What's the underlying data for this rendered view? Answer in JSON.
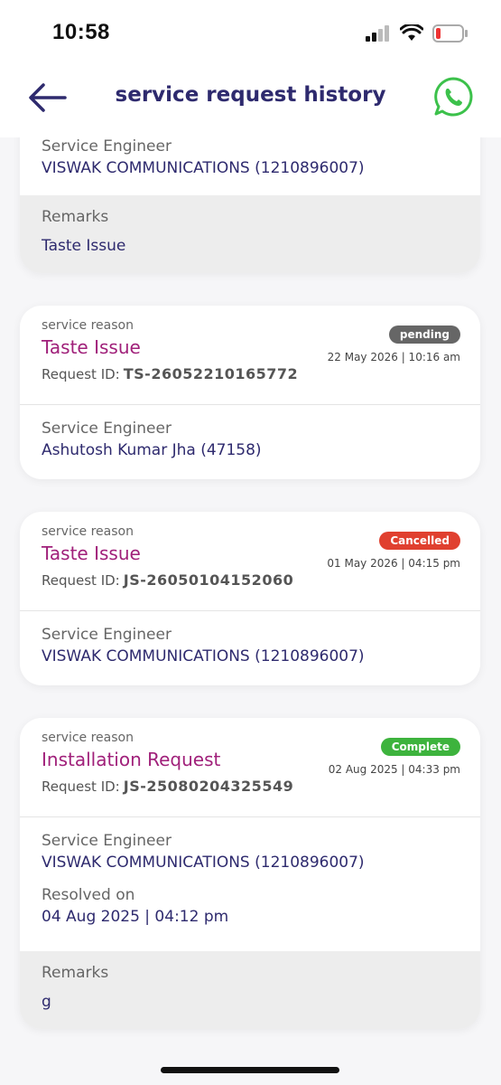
{
  "status": {
    "time": "10:58"
  },
  "header": {
    "title": "service request history"
  },
  "labels": {
    "service_reason": "service reason",
    "request_id": "Request ID:",
    "service_engineer": "Service Engineer",
    "remarks": "Remarks",
    "resolved_on": "Resolved on"
  },
  "cards": [
    {
      "engineer": "VISWAK COMMUNICATIONS (1210896007)",
      "remarks": "Taste Issue"
    },
    {
      "reason": "Taste Issue",
      "status": "pending",
      "status_color": "#666666",
      "date": "22 May 2026 | 10:16 am",
      "request_id": "TS-26052210165772",
      "engineer": "Ashutosh Kumar Jha (47158)"
    },
    {
      "reason": "Taste Issue",
      "status": "Cancelled",
      "status_color": "#e0402f",
      "date": "01 May 2026 | 04:15 pm",
      "request_id": "JS-26050104152060",
      "engineer": "VISWAK COMMUNICATIONS (1210896007)"
    },
    {
      "reason": "Installation Request",
      "status": "Complete",
      "status_color": "#3db33d",
      "date": "02 Aug 2025 | 04:33 pm",
      "request_id": "JS-25080204325549",
      "engineer": "VISWAK COMMUNICATIONS (1210896007)",
      "resolved_on": "04 Aug 2025 | 04:12 pm",
      "remarks": "g"
    }
  ]
}
